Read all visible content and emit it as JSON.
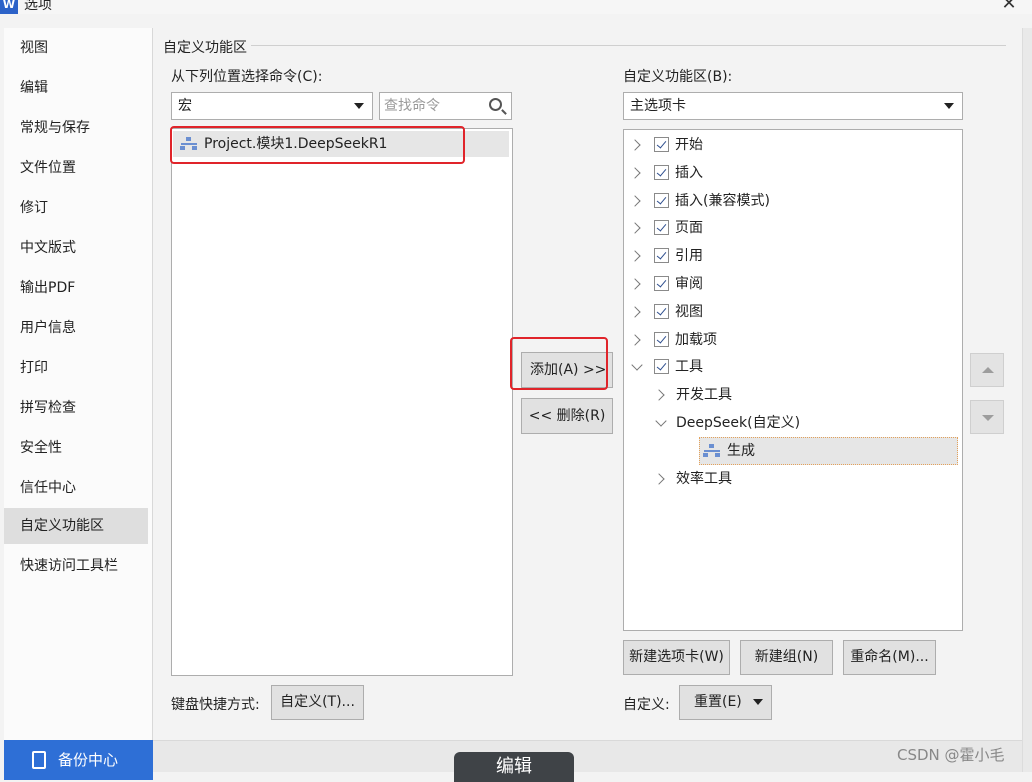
{
  "window": {
    "title": "选项",
    "close_glyph": "✕",
    "app_icon": "W"
  },
  "nav": {
    "items": [
      {
        "label": "视图"
      },
      {
        "label": "编辑"
      },
      {
        "label": "常规与保存"
      },
      {
        "label": "文件位置"
      },
      {
        "label": "修订"
      },
      {
        "label": "中文版式"
      },
      {
        "label": "输出PDF"
      },
      {
        "label": "用户信息"
      },
      {
        "label": "打印"
      },
      {
        "label": "拼写检查"
      },
      {
        "label": "安全性"
      },
      {
        "label": "信任中心"
      },
      {
        "label": "自定义功能区",
        "active": true
      },
      {
        "label": "快速访问工具栏"
      }
    ],
    "backup_label": "备份中心"
  },
  "section_title": "自定义功能区",
  "left_panel": {
    "label": "从下列位置选择命令(C):",
    "source_value": "宏",
    "search_placeholder": "查找命令",
    "commands": [
      "Project.模块1.DeepSeekR1"
    ]
  },
  "right_panel": {
    "label": "自定义功能区(B):",
    "tabs_value": "主选项卡",
    "tree": [
      {
        "label": "开始",
        "checked": true,
        "expanded": false
      },
      {
        "label": "插入",
        "checked": true,
        "expanded": false
      },
      {
        "label": "插入(兼容模式)",
        "checked": true,
        "expanded": false
      },
      {
        "label": "页面",
        "checked": true,
        "expanded": false
      },
      {
        "label": "引用",
        "checked": true,
        "expanded": false
      },
      {
        "label": "审阅",
        "checked": true,
        "expanded": false
      },
      {
        "label": "视图",
        "checked": true,
        "expanded": false
      },
      {
        "label": "加载项",
        "checked": true,
        "expanded": false
      },
      {
        "label": "工具",
        "checked": true,
        "expanded": true,
        "children": [
          {
            "label": "开发工具",
            "expanded": false
          },
          {
            "label": "DeepSeek(自定义)",
            "expanded": true,
            "children": [
              {
                "label": "生成",
                "selected": true
              }
            ]
          },
          {
            "label": "效率工具",
            "expanded": false
          }
        ]
      }
    ]
  },
  "buttons": {
    "add": "添加(A) >>",
    "remove": "<< 删除(R)",
    "new_tab": "新建选项卡(W)",
    "new_group": "新建组(N)",
    "rename": "重命名(M)...",
    "keyboard_label": "键盘快捷方式:",
    "keyboard_customize": "自定义(T)...",
    "customize_label": "自定义:",
    "reset": "重置(E)"
  },
  "overlay": {
    "bottom_tab": "编辑",
    "watermark": "CSDN @霍小毛"
  },
  "colors": {
    "highlight_red": "#e0242a",
    "accent_blue": "#2e6fd6"
  }
}
